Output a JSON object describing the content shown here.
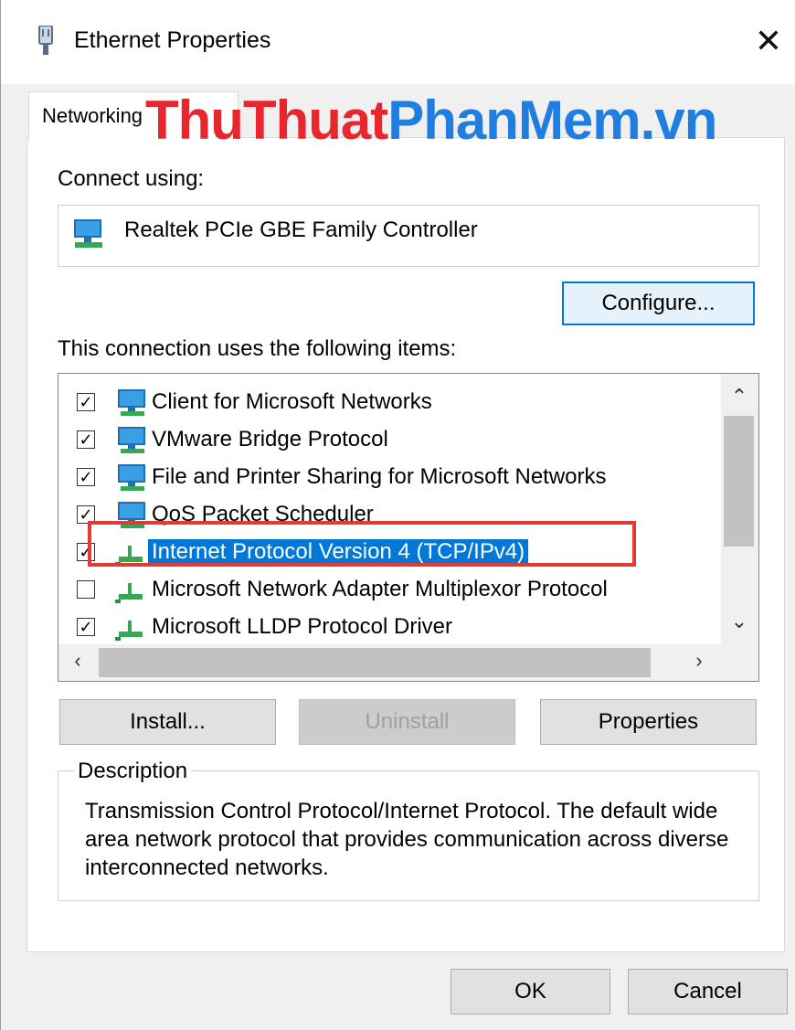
{
  "window": {
    "title": "Ethernet Properties"
  },
  "tab": {
    "label": "Networking"
  },
  "watermark": {
    "part1": "ThuThuat",
    "part2": "PhanMem",
    "part3": ".vn",
    "color1": "#e8262d",
    "color2": "#1f7ee0"
  },
  "connect": {
    "label": "Connect using:",
    "adapter": "Realtek PCIe GBE Family Controller",
    "configure_label": "Configure..."
  },
  "items": {
    "label": "This connection uses the following items:",
    "list": [
      {
        "label": "Client for Microsoft Networks",
        "checked": true,
        "icon": "network-client-icon"
      },
      {
        "label": "VMware Bridge Protocol",
        "checked": true,
        "icon": "network-service-icon"
      },
      {
        "label": "File and Printer Sharing for Microsoft Networks",
        "checked": true,
        "icon": "network-service-icon"
      },
      {
        "label": "QoS Packet Scheduler",
        "checked": true,
        "icon": "network-service-icon"
      },
      {
        "label": "Internet Protocol Version 4 (TCP/IPv4)",
        "checked": true,
        "selected": true,
        "icon": "network-protocol-icon"
      },
      {
        "label": "Microsoft Network Adapter Multiplexor Protocol",
        "checked": false,
        "icon": "network-protocol-icon"
      },
      {
        "label": "Microsoft LLDP Protocol Driver",
        "checked": true,
        "icon": "network-protocol-icon"
      }
    ]
  },
  "buttons": {
    "install": "Install...",
    "uninstall": "Uninstall",
    "properties": "Properties",
    "ok": "OK",
    "cancel": "Cancel"
  },
  "description": {
    "legend": "Description",
    "text": "Transmission Control Protocol/Internet Protocol. The default wide area network protocol that provides communication across diverse interconnected networks."
  },
  "colors": {
    "accent": "#0078d7",
    "highlight_box": "#e53935"
  }
}
